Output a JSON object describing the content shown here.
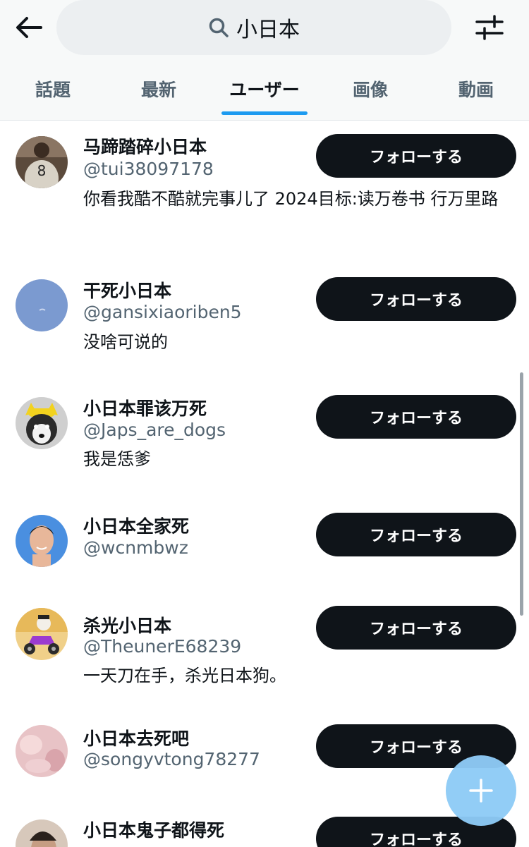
{
  "search": {
    "query": "小日本"
  },
  "icons": {
    "back": "arrow-left-icon",
    "search": "search-icon",
    "filter": "sliders-icon",
    "compose": "plus-icon"
  },
  "tabs": [
    {
      "label": "話題"
    },
    {
      "label": "最新"
    },
    {
      "label": "ユーザー",
      "active": true
    },
    {
      "label": "画像"
    },
    {
      "label": "動画"
    }
  ],
  "users": [
    {
      "name": "马蹄踏碎小日本",
      "handle": "@tui38097178",
      "bio": "你看我酷不酷就完事儿了 2024目标:读万卷书 行万里路",
      "follow_label": "フォローする"
    },
    {
      "name": "干死小日本",
      "handle": "@gansixiaoriben5",
      "bio": "没啥可说的",
      "follow_label": "フォローする"
    },
    {
      "name": "小日本罪该万死",
      "handle": "@Japs_are_dogs",
      "bio": "我是恁爹",
      "follow_label": "フォローする"
    },
    {
      "name": "小日本全家死",
      "handle": "@wcnmbwz",
      "bio": "",
      "follow_label": "フォローする"
    },
    {
      "name": "杀光小日本",
      "handle": "@TheunerE68239",
      "bio": "一天刀在手，杀光日本狗。",
      "follow_label": "フォローする"
    },
    {
      "name": "小日本去死吧",
      "handle": "@songyvtong78277",
      "bio": "",
      "follow_label": "フォローする"
    },
    {
      "name": "小日本鬼子都得死",
      "handle": "",
      "bio": "",
      "follow_label": "フォローする"
    }
  ],
  "colors": {
    "accent": "#1d9bf0",
    "button_bg": "#0f1419",
    "fab": "#8ecbf6"
  }
}
